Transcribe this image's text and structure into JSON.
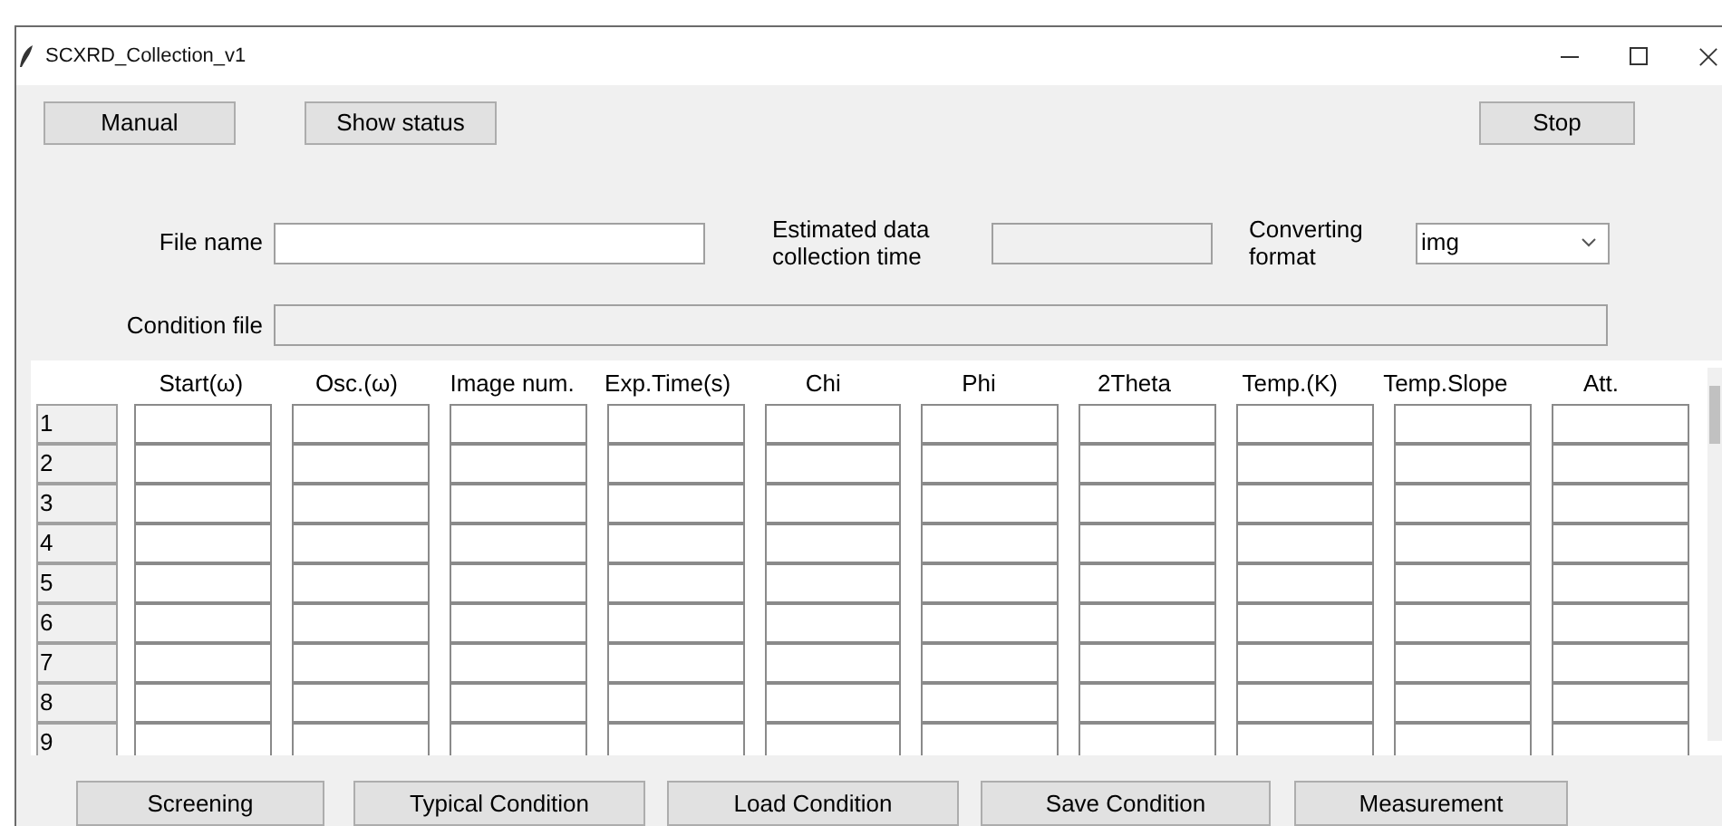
{
  "window": {
    "title": "SCXRD_Collection_v1"
  },
  "top_buttons": [
    {
      "label": "Manual"
    },
    {
      "label": "Show status"
    }
  ],
  "stop_button": {
    "label": "Stop"
  },
  "file_name": {
    "label": "File name"
  },
  "estimated_time": {
    "label": "Estimated data collection time"
  },
  "converting_format": {
    "label": "Converting format",
    "value": "img"
  },
  "condition_file": {
    "label": "Condition file"
  },
  "table": {
    "columns": [
      "Start(ω)",
      "Osc.(ω)",
      "Image num.",
      "Exp.Time(s)",
      "Chi",
      "Phi",
      "2Theta",
      "Temp.(K)",
      "Temp.Slope",
      "Att."
    ],
    "rows": [
      "1",
      "2",
      "3",
      "4",
      "5",
      "6",
      "7",
      "8",
      "9"
    ]
  },
  "bottom_buttons": [
    {
      "label": "Screening"
    },
    {
      "label": "Typical Condition"
    },
    {
      "label": "Load Condition"
    },
    {
      "label": "Save Condition"
    },
    {
      "label": "Measurement"
    }
  ]
}
